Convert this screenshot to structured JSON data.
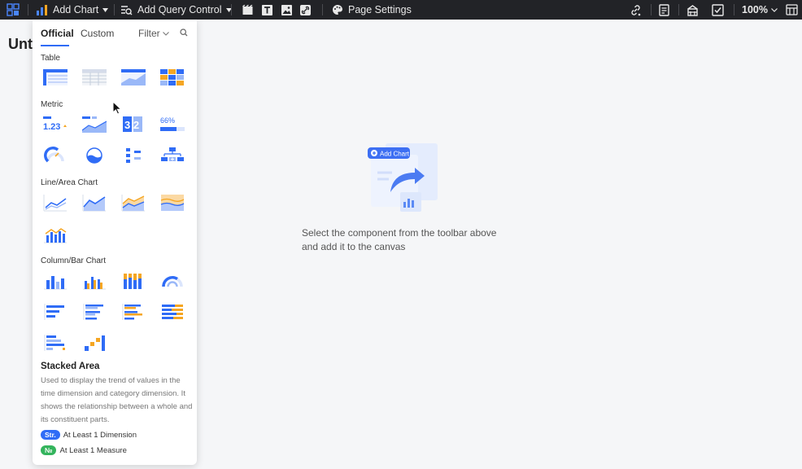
{
  "toolbar": {
    "add_chart_label": "Add Chart",
    "add_query_label": "Add Query Control",
    "page_settings_label": "Page Settings",
    "zoom_label": "100%"
  },
  "canvas": {
    "title": "Unt",
    "empty_line1": "Select the component from the toolbar above",
    "empty_line2": "and add it to the canvas",
    "illustration_label": "Add Chart"
  },
  "panel": {
    "tab_official": "Official",
    "tab_custom": "Custom",
    "filter_label": "Filter",
    "sections": {
      "table": "Table",
      "metric": "Metric",
      "line_area": "Line/Area Chart",
      "column_bar": "Column/Bar Chart"
    },
    "description": {
      "title": "Stacked Area",
      "text": "Used to display the trend of values in the time dimension and category dimension. It shows the relationship between a whole and its constituent parts."
    },
    "requirements": [
      {
        "badge": "Str.",
        "label": "At Least 1 Dimension",
        "color": "#2f6cf6"
      },
      {
        "badge": "№",
        "label": "At Least 1 Measure",
        "color": "#34b45d"
      }
    ],
    "metric_text_123": "1.23",
    "metric_text_32": "3 2",
    "metric_text_66": "66%"
  },
  "colors": {
    "accent": "#2f6cf6",
    "orange": "#f5a623",
    "toolbar_bg": "#222327"
  }
}
